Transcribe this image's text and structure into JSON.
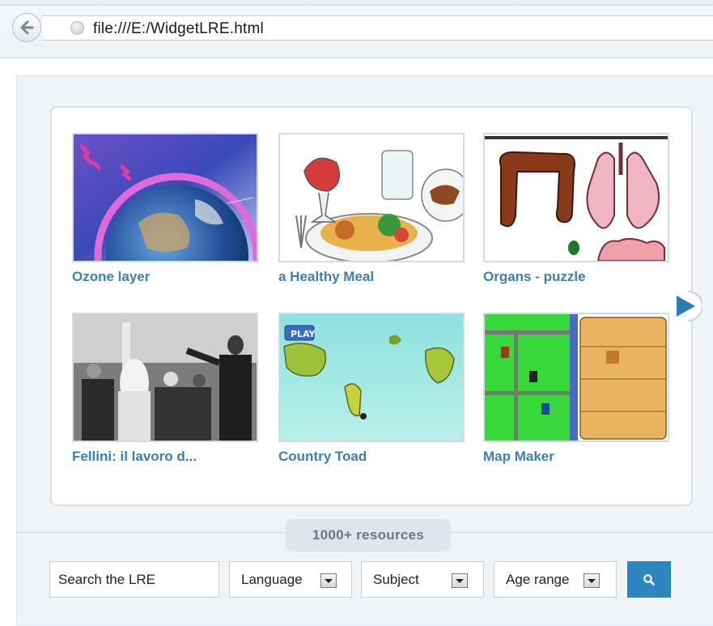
{
  "browser": {
    "url": "file:///E:/WidgetLRE.html"
  },
  "resources": [
    {
      "title": "Ozone layer",
      "image": "earth-ozone-illustration"
    },
    {
      "title": "a Healthy Meal",
      "image": "healthy-meal-illustration"
    },
    {
      "title": "Organs - puzzle",
      "image": "organs-puzzle-illustration"
    },
    {
      "title": "Fellini: il lavoro d...",
      "image": "black-white-film-still"
    },
    {
      "title": "Country Toad",
      "image": "country-toad-game-screen"
    },
    {
      "title": "Map Maker",
      "image": "map-maker-game-screen"
    }
  ],
  "resource_count": "1000+ resources",
  "search": {
    "placeholder": "Search the LRE",
    "language_label": "Language",
    "subject_label": "Subject",
    "age_label": "Age range"
  },
  "icons": {
    "back": "back-arrow-icon",
    "page": "globe-icon",
    "next": "next-arrow-icon",
    "search": "search-icon",
    "dropdown": "chevron-down-icon"
  },
  "colors": {
    "title_link": "#3a7fb7",
    "accent": "#2e86c1",
    "next_arrow": "#2b7db5"
  }
}
